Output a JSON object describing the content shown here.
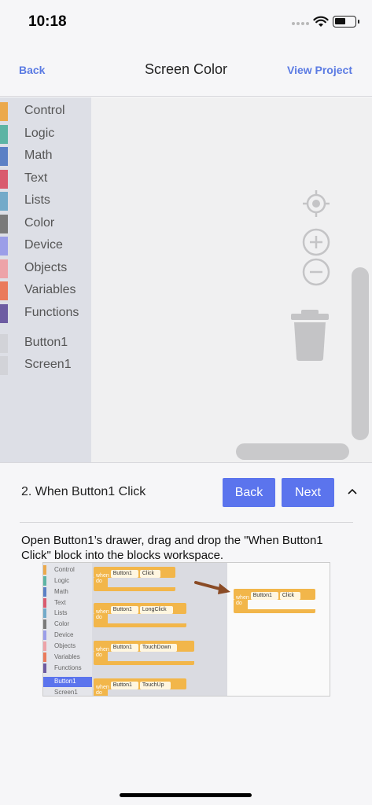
{
  "status": {
    "time": "10:18"
  },
  "nav": {
    "back": "Back",
    "title": "Screen Color",
    "view_project": "View Project"
  },
  "toolbox": {
    "categories": [
      {
        "label": "Control",
        "color": "#eba94c"
      },
      {
        "label": "Logic",
        "color": "#5db4a4"
      },
      {
        "label": "Math",
        "color": "#5b80c5"
      },
      {
        "label": "Text",
        "color": "#d95b6e"
      },
      {
        "label": "Lists",
        "color": "#73aac9"
      },
      {
        "label": "Color",
        "color": "#7a7a7a"
      },
      {
        "label": "Device",
        "color": "#9b9ee8"
      },
      {
        "label": "Objects",
        "color": "#eda3a8"
      },
      {
        "label": "Variables",
        "color": "#ea7a5b"
      },
      {
        "label": "Functions",
        "color": "#6d5ca2"
      }
    ],
    "components": [
      {
        "label": "Button1",
        "color": "#d2d3d8"
      },
      {
        "label": "Screen1",
        "color": "#d2d3d8"
      }
    ]
  },
  "step": {
    "title": "2. When Button1 Click",
    "back_label": "Back",
    "next_label": "Next",
    "instructions": "Open Button1’s drawer, drag and drop the \"When Button1 Click\" block into the blocks workspace."
  },
  "tutorial_image": {
    "toolbox": [
      "Control",
      "Logic",
      "Math",
      "Text",
      "Lists",
      "Color",
      "Device",
      "Objects",
      "Variables",
      "Functions",
      "Button1",
      "Screen1"
    ],
    "toolbox_colors": [
      "#eba94c",
      "#5db4a4",
      "#5b80c5",
      "#d95b6e",
      "#73aac9",
      "#7a7a7a",
      "#9b9ee8",
      "#eda3a8",
      "#ea7a5b",
      "#6d5ca2"
    ],
    "selected": "Button1",
    "when": "when",
    "do": "do",
    "component": "Button1",
    "events": [
      "Click",
      "LongClick",
      "TouchDown",
      "TouchUp"
    ],
    "dropped_event": "Click"
  }
}
